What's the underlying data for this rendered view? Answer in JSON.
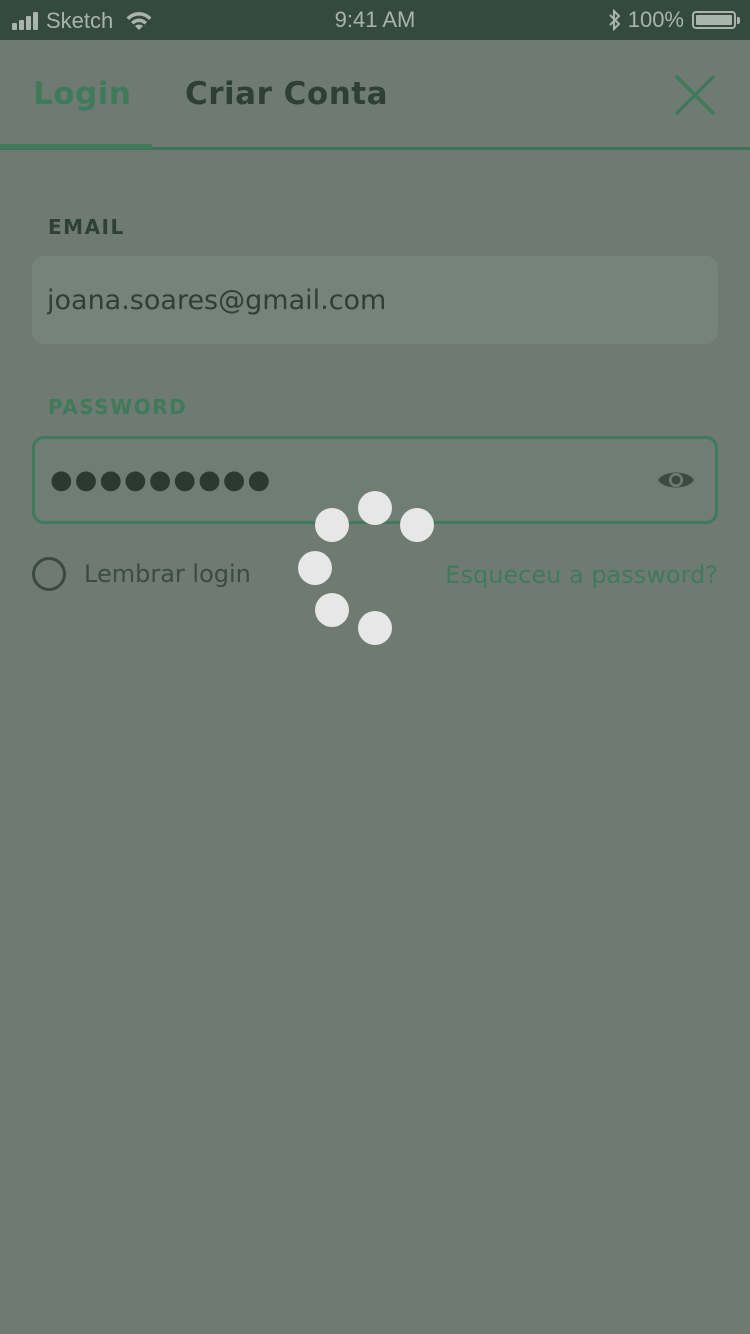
{
  "status_bar": {
    "carrier": "Sketch",
    "time": "9:41 AM",
    "battery": "100%"
  },
  "tabs": {
    "login": "Login",
    "create_account": "Criar Conta"
  },
  "form": {
    "email_label": "EMAIL",
    "email_value": "joana.soares@gmail.com",
    "password_label": "PASSWORD",
    "password_value": "●●●●●●●●●",
    "remember_label": "Lembrar login",
    "forgot_label": "Esqueceu a password?"
  },
  "colors": {
    "accent": "#3f7a5b",
    "overlay": "#6f7b72",
    "status_bar": "#344a3f"
  },
  "icons": {
    "close": "close-icon",
    "eye": "eye-icon",
    "spinner": "loading-spinner-icon"
  }
}
